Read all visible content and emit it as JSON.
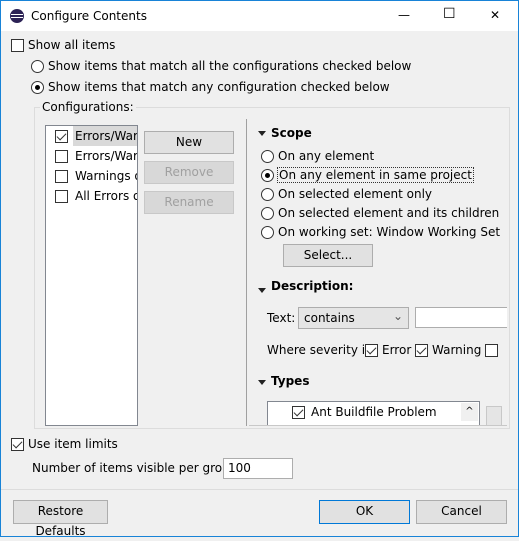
{
  "window": {
    "title": "Configure Contents",
    "minimize": "—",
    "maximize": "☐",
    "close": "✕"
  },
  "show_all_items": {
    "label": "Show all items",
    "checked": false
  },
  "match_all": {
    "label": "Show items that match all the configurations checked below",
    "selected": false
  },
  "match_any": {
    "label": "Show items that match any configuration checked below",
    "selected": true
  },
  "configurations": {
    "label": "Configurations:",
    "items": [
      {
        "label": "Errors/Warn",
        "checked": true,
        "selected": true
      },
      {
        "label": "Errors/Warn",
        "checked": false
      },
      {
        "label": "Warnings o",
        "checked": false
      },
      {
        "label": "All Errors or",
        "checked": false
      }
    ],
    "new": "New",
    "remove": "Remove",
    "rename": "Rename"
  },
  "scope": {
    "label": "Scope",
    "options": [
      "On any element",
      "On any element in same project",
      "On selected element only",
      "On selected element and its children",
      "On working set:  Window Working Set"
    ],
    "selected": 1,
    "select_button": "Select..."
  },
  "description": {
    "label": "Description:",
    "text_label": "Text:",
    "operator": "contains",
    "text_value": "",
    "severity_label": "Where severity is:",
    "error": {
      "label": "Error",
      "checked": true
    },
    "warning": {
      "label": "Warning",
      "checked": true
    },
    "info": {
      "checked": false
    }
  },
  "types": {
    "label": "Types",
    "items": [
      {
        "label": "Ant Buildfile Problem",
        "checked": true
      }
    ]
  },
  "limits": {
    "label": "Use item limits",
    "checked": true,
    "count_label": "Number of items visible per group:",
    "count_value": "100"
  },
  "footer": {
    "restore": "Restore Defaults",
    "ok": "OK",
    "cancel": "Cancel"
  }
}
